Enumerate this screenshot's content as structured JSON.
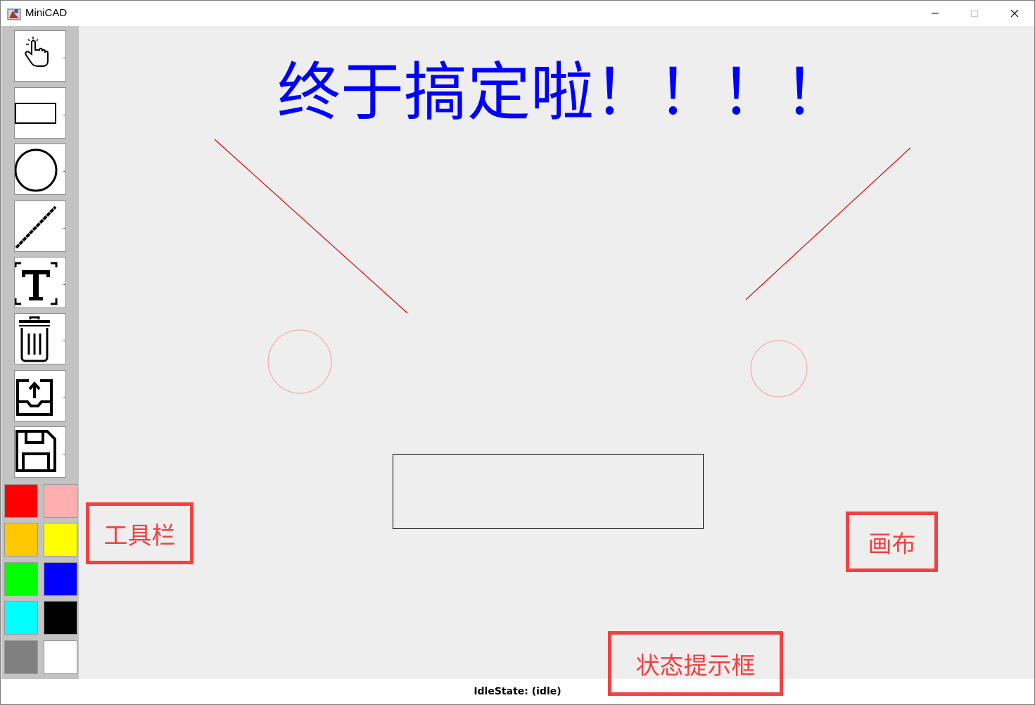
{
  "window": {
    "title": "MiniCAD"
  },
  "toolbar": {
    "tools": [
      {
        "name": "select-tool",
        "icon": "pointer-hand-icon"
      },
      {
        "name": "rectangle-tool",
        "icon": "rectangle-icon"
      },
      {
        "name": "circle-tool",
        "icon": "circle-icon"
      },
      {
        "name": "line-tool",
        "icon": "line-icon"
      },
      {
        "name": "text-tool",
        "icon": "text-icon"
      },
      {
        "name": "delete-tool",
        "icon": "trash-icon"
      },
      {
        "name": "open-tool",
        "icon": "upload-tray-icon"
      },
      {
        "name": "save-tool",
        "icon": "floppy-disk-icon"
      }
    ],
    "colors": [
      "#ff0000",
      "#ffafaf",
      "#ffc800",
      "#ffff00",
      "#00ff00",
      "#0000ff",
      "#00ffff",
      "#000000",
      "#808080",
      "#ffffff"
    ]
  },
  "canvas": {
    "text": "终于搞定啦！！！！",
    "text_color": "#0000ff",
    "shape_colors": {
      "lines": "#e00000",
      "circles": "#f49a9a",
      "rectangle": "#000000"
    }
  },
  "status": {
    "text": "IdleState: (idle)"
  },
  "annotations": {
    "toolbar_label": "工具栏",
    "canvas_label": "画布",
    "status_label": "状态提示框",
    "color": "#f24141"
  }
}
